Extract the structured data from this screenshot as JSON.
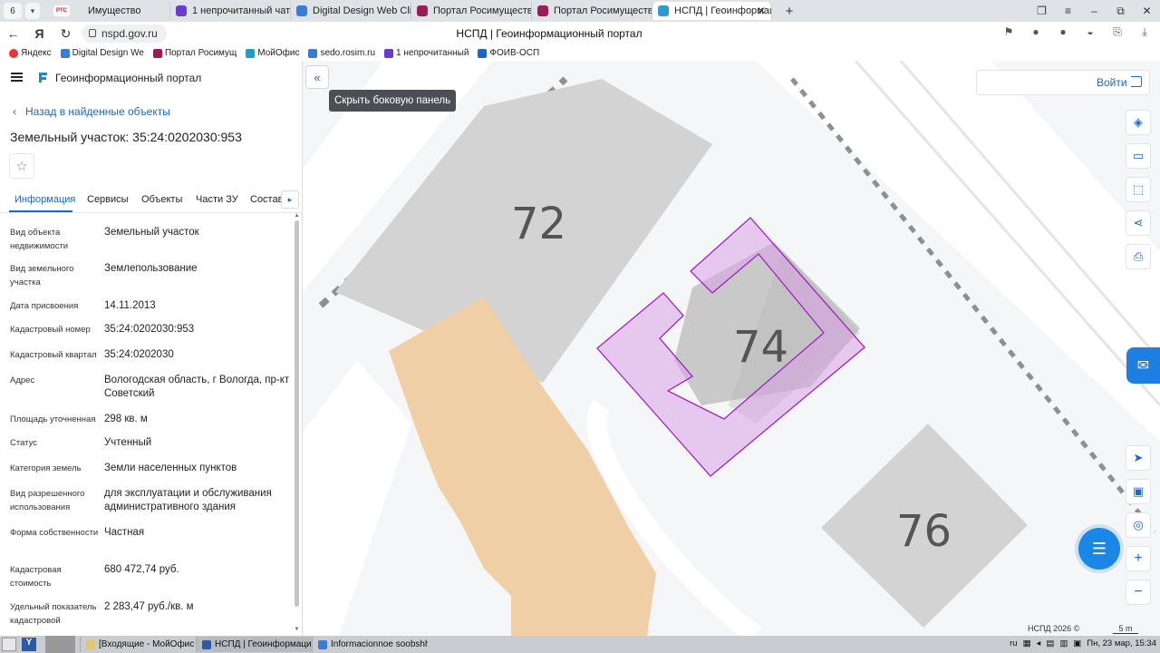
{
  "browser": {
    "tab_count": "6",
    "tabs": [
      {
        "label": "Имущество",
        "badge": "РТС"
      },
      {
        "label": "1 непрочитанный чат"
      },
      {
        "label": "Digital Design Web Client"
      },
      {
        "label": "Портал Росимущества"
      },
      {
        "label": "Портал Росимущества"
      },
      {
        "label": "НСПД | Геоинформаци"
      }
    ],
    "url": "nspd.gov.ru",
    "page_title": "НСПД | Геоинформационный портал",
    "bookmarks": [
      "Яндекс",
      "Digital Design We",
      "Портал Росимущ",
      "МойОфис",
      "sedo.rosim.ru",
      "1 непрочитанный",
      "ФОИВ-ОСП"
    ]
  },
  "sidebar": {
    "portal_name": "Геоинформационный портал",
    "back_link": "Назад в найденные объекты",
    "title": "Земельный участок: 35:24:0202030:953",
    "tabs": [
      "Информация",
      "Сервисы",
      "Объекты",
      "Части ЗУ",
      "Состав"
    ],
    "properties": [
      {
        "key": "Вид объекта недвижимости",
        "value": "Земельный участок"
      },
      {
        "key": "Вид земельного участка",
        "value": "Землепользование"
      },
      {
        "key": "Дата присвоения",
        "value": "14.11.2013"
      },
      {
        "key": "Кадастровый номер",
        "value": "35:24:0202030:953"
      },
      {
        "key": "Кадастровый квартал",
        "value": "35:24:0202030"
      },
      {
        "key": "Адрес",
        "value": "Вологодская область, г Вологда, пр-кт Советский"
      },
      {
        "key": "Площадь уточненная",
        "value": "298 кв. м"
      },
      {
        "key": "Статус",
        "value": "Учтенный"
      },
      {
        "key": "Категория земель",
        "value": "Земли населенных пунктов"
      },
      {
        "key": "Вид разрешенного использования",
        "value": "для эксплуатации и обслуживания административного здания"
      },
      {
        "key": "Форма собственности",
        "value": "Частная"
      },
      {
        "key": "Кадастровая стоимость",
        "value": "680 472,74 руб."
      },
      {
        "key": "Удельный показатель кадастровой стоимости",
        "value": "2 283,47 руб./кв. м"
      }
    ]
  },
  "map": {
    "tooltip": "Скрыть боковую панель",
    "login_label": "Войти",
    "building_numbers": [
      "72",
      "74",
      "76"
    ],
    "copyright": "НСПД 2026 ©",
    "scale_label": "5 m",
    "colors": {
      "accent": "#1a66d2",
      "parcel_stroke": "#a020c0",
      "parcel_fill": "#d9a3e8",
      "zone_fill": "#f0cfa6",
      "building": "#d3d3d3"
    }
  },
  "taskbar": {
    "apps": [
      "[Входящие - МойОфис П...",
      "НСПД | Геоинформацио...",
      "Informacionnoe soobshhe..."
    ],
    "lang": "ru",
    "clock": "Пн, 23 мар, 15:34"
  }
}
